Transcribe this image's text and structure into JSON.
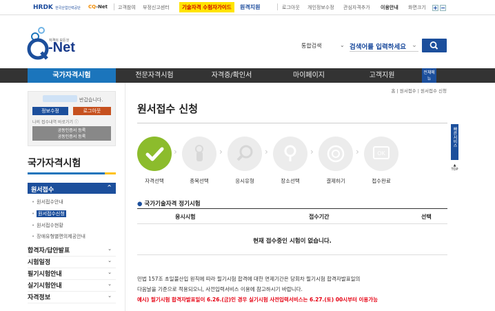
{
  "topbar": {
    "brand1": "HRDK",
    "brand1_sub": "한국산업인력공단",
    "brand2_prefix": "CQ",
    "brand2_suffix": "-Net",
    "links_left": [
      "고객참여",
      "부정신고센터"
    ],
    "guide": "기술자격 수험자가이드",
    "remote": "원격지원",
    "links_right": [
      "로그아웃",
      "개인정보수정",
      "관심자격추가",
      "이용안내",
      "화면크기"
    ],
    "zoom_in": "+",
    "zoom_out": "−"
  },
  "header": {
    "logo_tagline": "자격의 모든것",
    "logo_text": "Q-Net",
    "search_scope": "통합검색",
    "search_placeholder": "검색어를 입력하세요"
  },
  "gnb": {
    "items": [
      "국가자격시험",
      "전문자격시험",
      "자격증/확인서",
      "마이페이지",
      "고객지원"
    ],
    "all_menu": "전체메뉴"
  },
  "user_box": {
    "welcome": "반갑습니다.",
    "info_button": "정보수정",
    "logout_button": "로그아웃",
    "shortcut": "나의 접수내역 바로가기 ⓘ",
    "cert_line1": "공동인증서 등록",
    "cert_line2": "공동인증서 등록"
  },
  "sidebar": {
    "title": "국가자격시험",
    "section": "원서접수",
    "section_chevron": "^",
    "sub_items": [
      "원서접수안내",
      "원서접수신청",
      "원서접수현황",
      "장애유형별편의제공안내"
    ],
    "menus": [
      "합격자/답안발표",
      "시험일정",
      "필기시험안내",
      "실기시험안내",
      "자격정보"
    ]
  },
  "main": {
    "breadcrumb": "홈 | 원서접수 | 원서접수 신청",
    "title": "원서접수 신청",
    "steps": [
      "자격선택",
      "종목선택",
      "응시유형",
      "장소선택",
      "결제하기",
      "접수완료"
    ],
    "step_current": 1,
    "section_title": "국가기술자격 정기시험",
    "table_headers": [
      "응시시험",
      "접수기간",
      "선택"
    ],
    "empty_message": "현재 접수중인 시험이 없습니다.",
    "notice_1": "민법 157조 초일불산입 원칙에 따라 필기시험 합격에 대한 면제기간은 당회차 필기시험 합격자발표일의",
    "notice_2": "다음날을 기준으로 적용되오니, 사전입력서비스 이용에 참고하시기 바랍니다.",
    "notice_red": "예시) 필기시험 합격자발표일이 6.26.(금)인 경우 실기시험 사전입력서비스는 6.27.(토) 00시부터 이용가능"
  },
  "quick": {
    "label": "빠른서비스",
    "top": "TOP"
  },
  "colors": {
    "primary": "#1c4f9c",
    "accent_blue": "#1b75bc",
    "step_active": "#8cbc2c",
    "warning": "#e60012",
    "highlight": "#ffe400"
  }
}
